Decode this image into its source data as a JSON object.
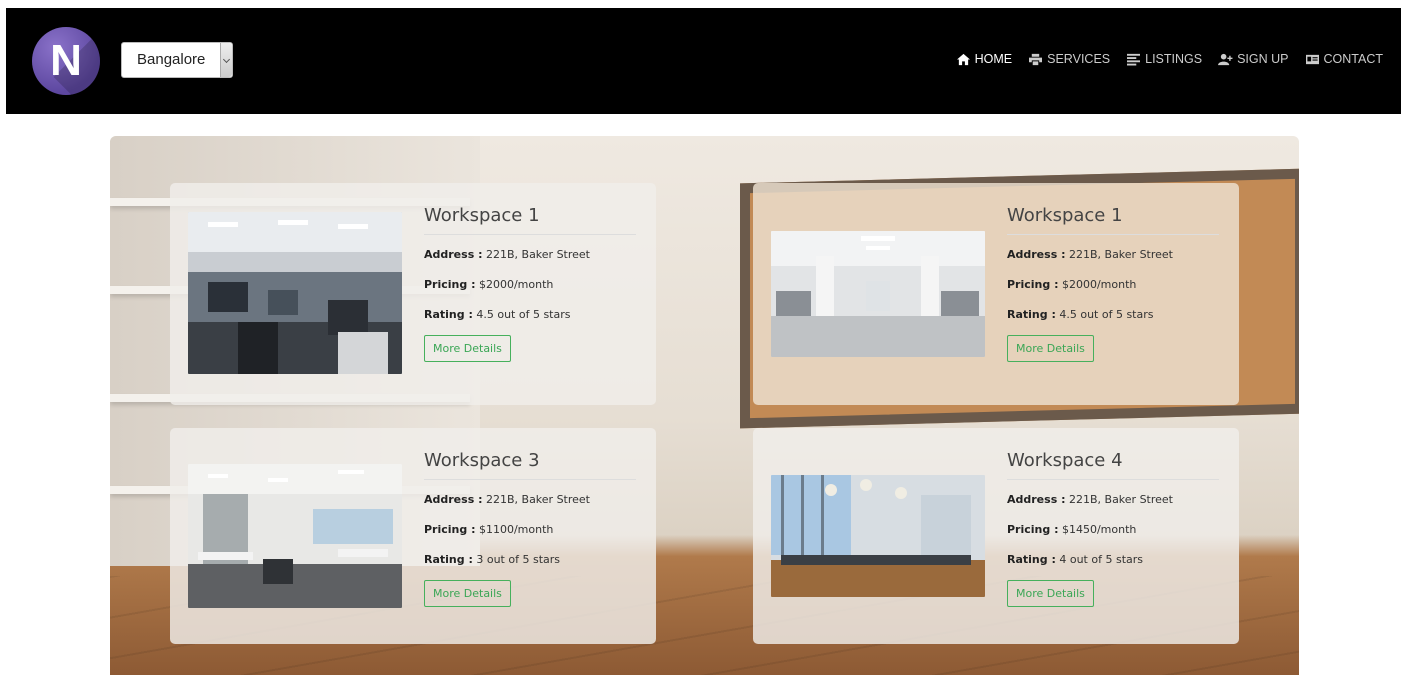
{
  "brand": {
    "logo_letter": "N"
  },
  "city_select": {
    "value": "Bangalore"
  },
  "nav": [
    {
      "icon": "home-icon",
      "label": "HOME"
    },
    {
      "icon": "print-icon",
      "label": "SERVICES"
    },
    {
      "icon": "list-icon",
      "label": "LISTINGS"
    },
    {
      "icon": "add-user-icon",
      "label": "SIGN UP"
    },
    {
      "icon": "contact-card-icon",
      "label": "CONTACT"
    }
  ],
  "labels": {
    "address": "Address :",
    "pricing": "Pricing :",
    "rating": "Rating :"
  },
  "workspaces": [
    {
      "title": "Workspace 1",
      "address": "221B, Baker Street",
      "pricing": "$2000/month",
      "rating": "4.5 out of 5 stars",
      "button": "More Details"
    },
    {
      "title": "Workspace 1",
      "address": "221B, Baker Street",
      "pricing": "$2000/month",
      "rating": "4.5 out of 5 stars",
      "button": "More Details"
    },
    {
      "title": "Workspace 3",
      "address": "221B, Baker Street",
      "pricing": "$1100/month",
      "rating": "3 out of 5 stars",
      "button": "More Details"
    },
    {
      "title": "Workspace 4",
      "address": "221B, Baker Street",
      "pricing": "$1450/month",
      "rating": "4 out of 5 stars",
      "button": "More Details"
    }
  ]
}
